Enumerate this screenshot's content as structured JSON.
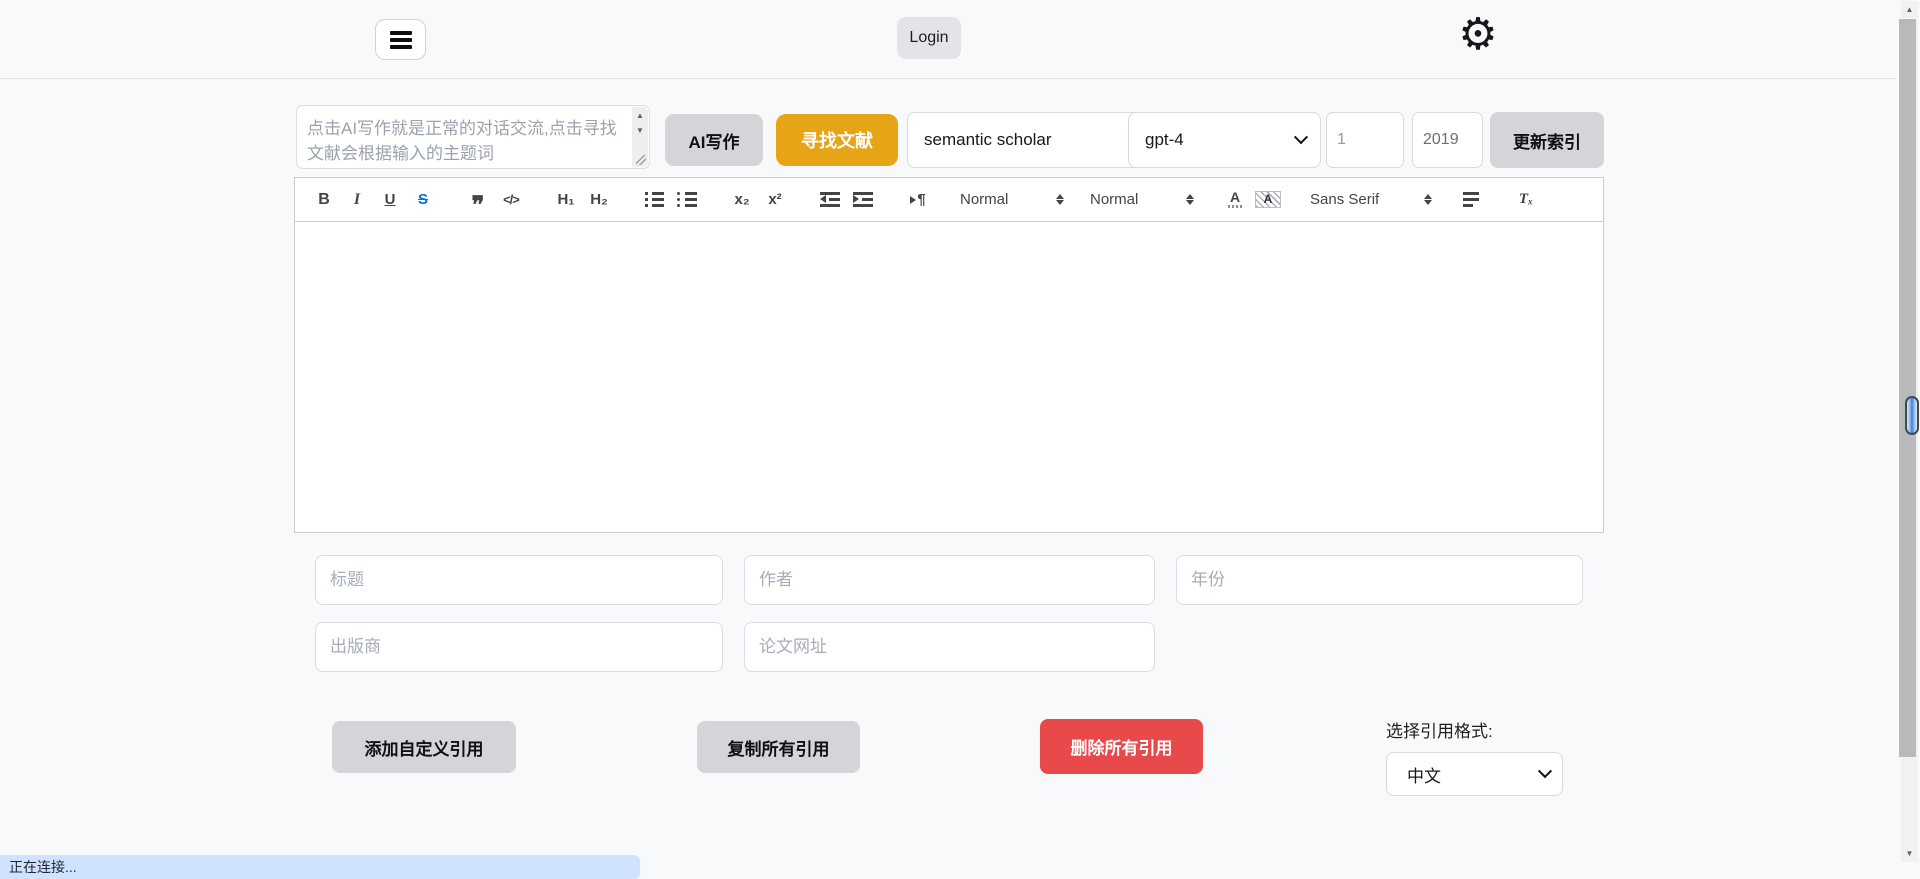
{
  "header": {
    "login_label": "Login"
  },
  "controls": {
    "prompt_placeholder": "点击AI写作就是正常的对话交流,点击寻找文献会根据输入的主题词",
    "ai_write_label": "AI写作",
    "find_literature_label": "寻找文献",
    "search_engine_value": "semantic scholar",
    "model_value": "gpt-4",
    "count_value": "1",
    "year_value": "2019",
    "update_index_label": "更新索引"
  },
  "toolbar": {
    "bold": "B",
    "italic": "I",
    "underline": "U",
    "strike": "S",
    "blockquote": "❞",
    "code_block": "</>",
    "header_1": "H₁",
    "header_2": "H₂",
    "subscript": "x₂",
    "superscript": "x²",
    "direction": "¶",
    "size_label": "Normal",
    "header_label": "Normal",
    "color_letter": "A",
    "background_letter": "A",
    "font_label": "Sans Serif",
    "clean": "Tₓ"
  },
  "citation_form": {
    "title_placeholder": "标题",
    "author_placeholder": "作者",
    "year_placeholder": "年份",
    "publisher_placeholder": "出版商",
    "url_placeholder": "论文网址",
    "add_custom_label": "添加自定义引用",
    "copy_all_label": "复制所有引用",
    "delete_all_label": "删除所有引用",
    "format_label": "选择引用格式:",
    "format_value": "中文"
  },
  "status": {
    "connecting": "正在连接..."
  },
  "colors": {
    "accent_yellow": "#e6a517",
    "danger_red": "#e8494b",
    "status_bg": "#cfe2ff",
    "strike_active_blue": "#0b6fd6"
  }
}
